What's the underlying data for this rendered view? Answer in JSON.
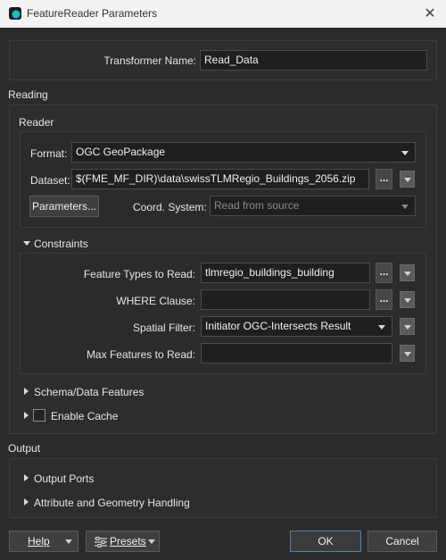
{
  "window": {
    "title": "FeatureReader Parameters"
  },
  "transformer": {
    "name_label": "Transformer Name:",
    "name_value": "Read_Data"
  },
  "reading": {
    "section_label": "Reading",
    "reader_group_label": "Reader",
    "format_label": "Format:",
    "format_value": "OGC GeoPackage",
    "dataset_label": "Dataset:",
    "dataset_value": "$(FME_MF_DIR)\\data\\swissTLMRegio_Buildings_2056.zip",
    "ellipsis": "...",
    "parameters_button": "Parameters...",
    "coord_label": "Coord. System:",
    "coord_value": "Read from source"
  },
  "constraints": {
    "header": "Constraints",
    "feature_types_label": "Feature Types to Read:",
    "feature_types_value": "tlmregio_buildings_building",
    "where_label": "WHERE Clause:",
    "where_value": "",
    "spatial_filter_label": "Spatial Filter:",
    "spatial_filter_value": "Initiator OGC-Intersects Result",
    "max_features_label": "Max Features to Read:",
    "max_features_value": ""
  },
  "schema_section": {
    "label": "Schema/Data Features"
  },
  "cache": {
    "label": "Enable Cache",
    "checked": false
  },
  "output": {
    "section_label": "Output",
    "output_ports_label": "Output Ports",
    "attr_geom_label": "Attribute and Geometry Handling"
  },
  "footer": {
    "help": "Help",
    "presets": "Presets",
    "ok": "OK",
    "cancel": "Cancel"
  },
  "colors": {
    "accent": "#4a7fb8",
    "background": "#2b2b2b",
    "field": "#1f1f1f"
  }
}
